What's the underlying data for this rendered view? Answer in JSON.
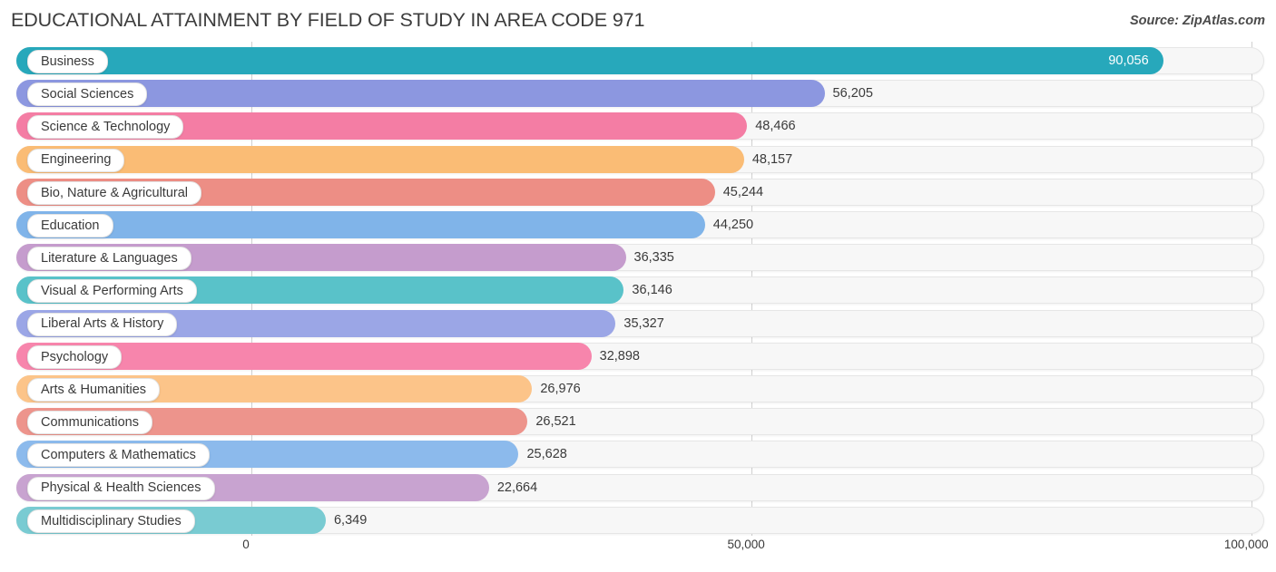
{
  "header": {
    "title": "EDUCATIONAL ATTAINMENT BY FIELD OF STUDY IN AREA CODE 971",
    "source": "Source: ZipAtlas.com"
  },
  "chart_data": {
    "type": "bar",
    "orientation": "horizontal",
    "title": "EDUCATIONAL ATTAINMENT BY FIELD OF STUDY IN AREA CODE 971",
    "xlabel": "",
    "ylabel": "",
    "xlim": [
      0,
      100000
    ],
    "grid": true,
    "legend": "none",
    "xticks": [
      "0",
      "50,000",
      "100,000"
    ],
    "xtick_values": [
      0,
      50000,
      100000
    ],
    "categories": [
      "Business",
      "Social Sciences",
      "Science & Technology",
      "Engineering",
      "Bio, Nature & Agricultural",
      "Education",
      "Literature & Languages",
      "Visual & Performing Arts",
      "Liberal Arts & History",
      "Psychology",
      "Arts & Humanities",
      "Communications",
      "Computers & Mathematics",
      "Physical & Health Sciences",
      "Multidisciplinary Studies"
    ],
    "values": [
      90056,
      56205,
      48466,
      48157,
      45244,
      44250,
      36335,
      36146,
      35327,
      32898,
      26976,
      26521,
      25628,
      22664,
      6349
    ],
    "value_labels": [
      "90,056",
      "56,205",
      "48,466",
      "48,157",
      "45,244",
      "44,250",
      "36,335",
      "36,146",
      "35,327",
      "32,898",
      "26,976",
      "26,521",
      "25,628",
      "22,664",
      "6,349"
    ],
    "colors": [
      "#27a8bb",
      "#8c97e0",
      "#f47da4",
      "#fabc75",
      "#ed8e85",
      "#80b4e9",
      "#c59ccd",
      "#59c2c9",
      "#9ba6e6",
      "#f785ac",
      "#fcc489",
      "#ed948c",
      "#8cbaec",
      "#c8a3d0",
      "#79cbd2"
    ]
  }
}
